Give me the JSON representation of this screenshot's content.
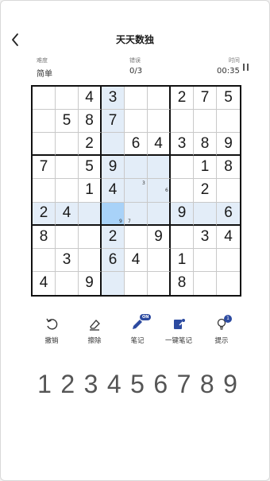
{
  "header": {
    "title": "天天数独"
  },
  "status": {
    "difficulty_label": "难度",
    "difficulty_value": "简单",
    "errors_label": "错误",
    "errors_value": "0/3",
    "time_label": "时间",
    "time_value": "00:35"
  },
  "board": {
    "selected": [
      5,
      3
    ],
    "highlight_rows": [
      5
    ],
    "highlight_cols": [
      3
    ],
    "highlight_box": [
      3,
      3
    ],
    "cells": [
      [
        "",
        "",
        "4",
        "3",
        "",
        "",
        "2",
        "7",
        "5"
      ],
      [
        "",
        "5",
        "8",
        "7",
        "",
        "",
        "",
        "",
        ""
      ],
      [
        "",
        "",
        "2",
        "",
        "6",
        "4",
        "3",
        "8",
        "9"
      ],
      [
        "7",
        "",
        "5",
        "9",
        "",
        "",
        "",
        "1",
        "8"
      ],
      [
        "",
        "",
        "1",
        "4",
        "",
        "",
        "",
        "2",
        ""
      ],
      [
        "2",
        "4",
        "",
        "",
        "",
        "",
        "9",
        "",
        "6"
      ],
      [
        "8",
        "",
        "",
        "2",
        "",
        "9",
        "",
        "3",
        "4"
      ],
      [
        "",
        "3",
        "",
        "6",
        "4",
        "",
        "1",
        "",
        ""
      ],
      [
        "4",
        "",
        "9",
        "",
        "",
        "",
        "8",
        "",
        ""
      ]
    ],
    "notes": [
      {
        "row": 4,
        "col": 4,
        "value": "3"
      },
      {
        "row": 4,
        "col": 5,
        "value": "6"
      },
      {
        "row": 5,
        "col": 3,
        "value": "9"
      },
      {
        "row": 5,
        "col": 4,
        "value": "7"
      }
    ]
  },
  "tools": [
    {
      "id": "undo",
      "label": "撤销",
      "icon": "undo-icon"
    },
    {
      "id": "erase",
      "label": "擦除",
      "icon": "eraser-icon"
    },
    {
      "id": "notes",
      "label": "笔记",
      "icon": "pencil-icon",
      "badge": "ON"
    },
    {
      "id": "auto-notes",
      "label": "一键笔记",
      "icon": "auto-notes-icon"
    },
    {
      "id": "hint",
      "label": "提示",
      "icon": "lightbulb-icon",
      "badge": "1"
    }
  ],
  "numpad": [
    "1",
    "2",
    "3",
    "4",
    "5",
    "6",
    "7",
    "8",
    "9"
  ],
  "colors": {
    "highlight": "#e3edf8",
    "selected": "#a8d2f8",
    "accent": "#2c4aa0"
  }
}
